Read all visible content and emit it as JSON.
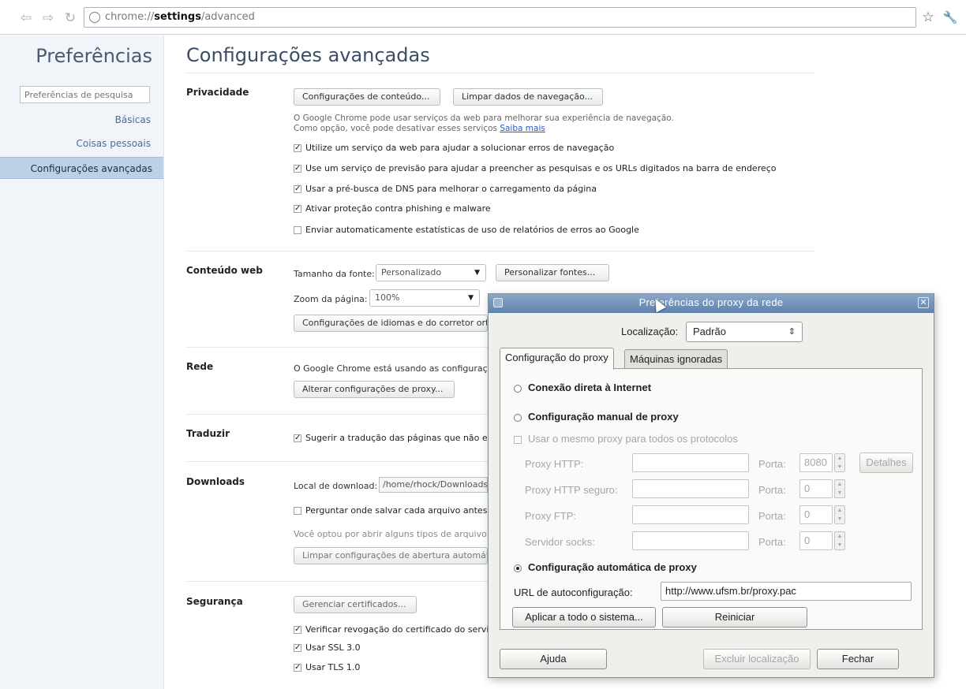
{
  "browser": {
    "url_scheme": "chrome://",
    "url_host": "settings",
    "url_path": "/advanced",
    "back_icon": "back-arrow-icon",
    "forward_icon": "forward-arrow-icon",
    "reload_icon": "reload-icon",
    "bookmark_icon": "star-icon",
    "menu_icon": "wrench-icon"
  },
  "sidebar": {
    "title": "Preferências",
    "search_placeholder": "Preferências de pesquisa",
    "items": [
      {
        "label": "Básicas",
        "selected": false
      },
      {
        "label": "Coisas pessoais",
        "selected": false
      },
      {
        "label": "Configurações avançadas",
        "selected": true
      }
    ]
  },
  "page": {
    "title": "Configurações avançadas",
    "privacy": {
      "label": "Privacidade",
      "content_settings_button": "Configurações de conteúdo...",
      "clear_data_button": "Limpar dados de navegação...",
      "note_line1": "O Google Chrome pode usar serviços da web para melhorar sua experiência de navegação.",
      "note_line2": "Como opção, você pode desativar esses serviços",
      "learn_more": "Saiba mais",
      "checkboxes": [
        {
          "label": "Utilize um serviço da web para ajudar a solucionar erros de navegação",
          "checked": true
        },
        {
          "label": "Use um serviço de previsão para ajudar a preencher as pesquisas e os URLs digitados na barra de endereço",
          "checked": true
        },
        {
          "label": "Usar a pré-busca de DNS para melhorar o carregamento da página",
          "checked": true
        },
        {
          "label": "Ativar proteção contra phishing e malware",
          "checked": true
        },
        {
          "label": "Enviar automaticamente estatísticas de uso de relatórios de erros ao Google",
          "checked": false
        }
      ]
    },
    "web_content": {
      "label": "Conteúdo web",
      "font_size_label": "Tamanho da fonte:",
      "font_size_value": "Personalizado",
      "customize_fonts_button": "Personalizar fontes...",
      "page_zoom_label": "Zoom da página:",
      "page_zoom_value": "100%",
      "language_button": "Configurações de idiomas e do corretor ort"
    },
    "network": {
      "label": "Rede",
      "text": "O Google Chrome está usando as configuraç",
      "proxy_button": "Alterar configurações de proxy..."
    },
    "translate": {
      "label": "Traduzir",
      "checkbox": "Sugerir a tradução das páginas que não es",
      "checked": true
    },
    "downloads": {
      "label": "Downloads",
      "location_label": "Local de download:",
      "location_value": "/home/rhock/Downloads",
      "ask_checkbox": "Perguntar onde salvar cada arquivo antes",
      "ask_checked": false,
      "auto_open_text": "Você optou por abrir alguns tipos de arquivo a",
      "clear_auto_open_button": "Limpar configurações de abertura automáti"
    },
    "security": {
      "label": "Segurança",
      "manage_certs_button": "Gerenciar certificados...",
      "checkboxes": [
        {
          "label": "Verificar revogação do certificado do servi",
          "checked": true
        },
        {
          "label": "Usar SSL 3.0",
          "checked": true
        },
        {
          "label": "Usar TLS 1.0",
          "checked": true
        }
      ]
    }
  },
  "dialog": {
    "title": "Preferências do proxy da rede",
    "location_label": "Localização:",
    "location_value": "Padrão",
    "tabs": [
      {
        "label": "Configuração do proxy",
        "active": true
      },
      {
        "label": "Máquinas ignoradas",
        "active": false
      }
    ],
    "direct_label": "Conexão direta à Internet",
    "manual_label": "Configuração manual de proxy",
    "same_proxy_label": "Usar o mesmo proxy para todos os protocolos",
    "http_label": "Proxy HTTP:",
    "https_label": "Proxy HTTP seguro:",
    "ftp_label": "Proxy FTP:",
    "socks_label": "Servidor socks:",
    "port_label": "Porta:",
    "http_port": "8080",
    "https_port": "0",
    "ftp_port": "0",
    "socks_port": "0",
    "details_button": "Detalhes",
    "auto_label": "Configuração automática de proxy",
    "autoconfig_url_label": "URL de autoconfiguração:",
    "autoconfig_url_value": "http://www.ufsm.br/proxy.pac",
    "apply_system_button": "Aplicar a todo o sistema...",
    "reset_button": "Reiniciar",
    "help_button": "Ajuda",
    "delete_location_button": "Excluir localização",
    "close_button": "Fechar",
    "selected_mode": "auto"
  }
}
